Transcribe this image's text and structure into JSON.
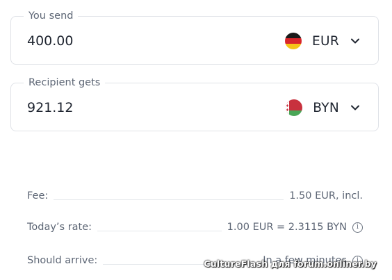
{
  "send": {
    "legend": "You send",
    "amount": "400.00",
    "currency_code": "EUR",
    "flag_icon": "germany-flag-icon"
  },
  "receive": {
    "legend": "Recipient gets",
    "amount": "921.12",
    "currency_code": "BYN",
    "flag_icon": "belarus-flag-icon"
  },
  "details": {
    "fee_label": "Fee:",
    "fee_value": "1.50 EUR, incl.",
    "rate_label": "Today’s rate:",
    "rate_value": "1.00 EUR = 2.3115 BYN",
    "arrive_label": "Should arrive:",
    "arrive_value": "In a few minutes"
  },
  "watermark": "CultureFlash для forum.onliner.by",
  "colors": {
    "text": "#1f2530",
    "muted": "#5d6675",
    "border": "#dfe2e7"
  }
}
